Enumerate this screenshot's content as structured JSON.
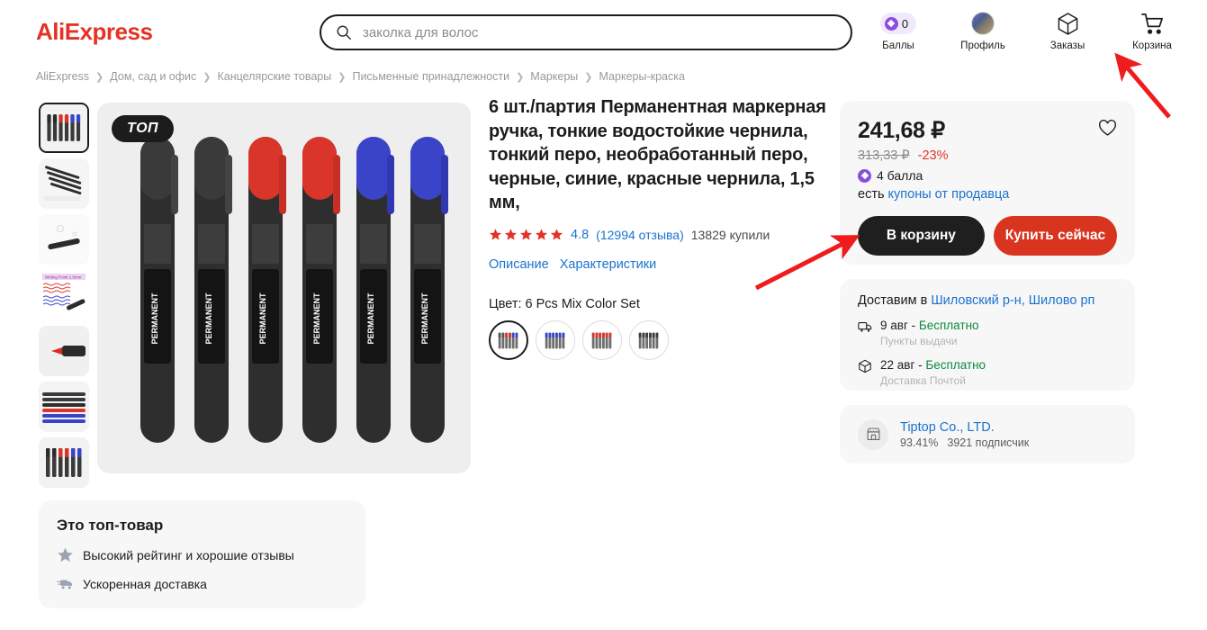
{
  "header": {
    "logo": "AliExpress",
    "search": {
      "value": "заколка для волос",
      "icon": "search-icon"
    },
    "actions": [
      {
        "label": "Баллы",
        "icon": "points-diamond-icon",
        "count": "0"
      },
      {
        "label": "Профиль",
        "icon": "avatar-icon"
      },
      {
        "label": "Заказы",
        "icon": "box-icon"
      },
      {
        "label": "Корзина",
        "icon": "cart-icon"
      }
    ]
  },
  "breadcrumb": [
    "AliExpress",
    "Дом, сад и офис",
    "Канцелярские товары",
    "Письменные принадлежности",
    "Маркеры",
    "Маркеры-краска"
  ],
  "gallery": {
    "badge": "ТОП",
    "thumbs": [
      {
        "name": "thumb-pens-row"
      },
      {
        "name": "thumb-pens-fan"
      },
      {
        "name": "thumb-pen-closeup"
      },
      {
        "name": "thumb-writing-sample"
      },
      {
        "name": "thumb-red-tip"
      },
      {
        "name": "thumb-pen-stack"
      },
      {
        "name": "thumb-pens-colors"
      }
    ]
  },
  "product": {
    "title": "6 шт./партия Перманентная маркерная ручка, тонкие водостойкие чернила, тонкий перо, необработанный перо, черные, синие, красные чернила, 1,5 мм,",
    "rating": "4.8",
    "reviews": "(12994 отзыва)",
    "bought": "13829 купили",
    "stars": 5,
    "links": [
      {
        "label": "Описание"
      },
      {
        "label": "Характеристики"
      }
    ],
    "color_label": "Цвет: 6 Pcs Mix Color Set",
    "swatches": [
      {
        "name": "swatch-mix-color-set",
        "selected": true,
        "colors": [
          "#5a5a5a",
          "#5a5a5a",
          "#d9352a",
          "#d9352a",
          "#3a44c9",
          "#3a44c9"
        ]
      },
      {
        "name": "swatch-blue-set",
        "selected": false,
        "colors": [
          "#3a44c9",
          "#3a44c9",
          "#3a44c9",
          "#3a44c9",
          "#3a44c9",
          "#3a44c9"
        ]
      },
      {
        "name": "swatch-red-set",
        "selected": false,
        "colors": [
          "#d9352a",
          "#d9352a",
          "#d9352a",
          "#d9352a",
          "#d9352a",
          "#d9352a"
        ]
      },
      {
        "name": "swatch-black-set",
        "selected": false,
        "colors": [
          "#4a4a4a",
          "#4a4a4a",
          "#4a4a4a",
          "#4a4a4a",
          "#4a4a4a",
          "#4a4a4a"
        ]
      }
    ]
  },
  "buy": {
    "price": "241,68 ₽",
    "old_price": "313,33 ₽",
    "discount": "-23%",
    "points": "4 балла",
    "coupon_prefix": "есть",
    "coupon_link": "купоны от продавца",
    "add_to_cart": "В корзину",
    "buy_now": "Купить сейчас",
    "favorite_icon": "heart-icon"
  },
  "shipping": {
    "title_prefix": "Доставим в",
    "location": "Шиловский р-н, Шилово рп",
    "options": [
      {
        "icon": "truck-icon",
        "date": "9 авг -",
        "price": "Бесплатно",
        "method": "Пункты выдачи"
      },
      {
        "icon": "box-icon",
        "date": "22 авг -",
        "price": "Бесплатно",
        "method": "Доставка Почтой"
      }
    ]
  },
  "seller": {
    "icon": "store-icon",
    "name": "Tiptop Co., LTD.",
    "rating": "93.41%",
    "followers": "3921 подписчик"
  },
  "top_product": {
    "title": "Это топ-товар",
    "features": [
      {
        "icon": "star-icon",
        "label": "Высокий рейтинг и хорошие отзывы"
      },
      {
        "icon": "truck-fast-icon",
        "label": "Ускоренная доставка"
      }
    ]
  },
  "colors": {
    "brand": "#e43225",
    "link": "#1a73cf",
    "buy_button": "#d8341f",
    "cart_button": "#1f1f1f",
    "free_green": "#0c8a3e",
    "points_purple": "#8b4ddb",
    "annotation_arrow": "#ee1c1c"
  }
}
